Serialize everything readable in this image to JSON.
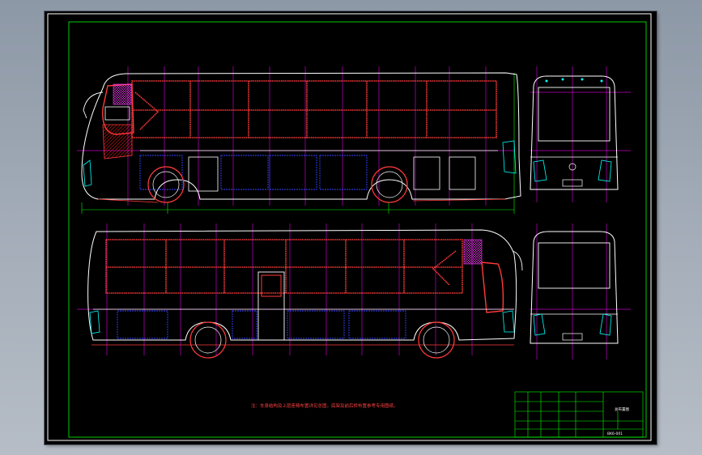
{
  "note_text": "注：车身结构及上层座椅布置详见总图，底架及前后桥布置参考专用图纸。",
  "title_block": {
    "drawing_name": "总布置图",
    "drawing_number": "BK6-001"
  },
  "colors": {
    "frame": "#ffffff",
    "border": "#00ff00",
    "body": "#ffffff",
    "frame_members": "#ff3a3a",
    "panels": "#3344ff",
    "grid_lines": "#c000c0",
    "lights": "#00ffff",
    "hatch": "#ff2020"
  }
}
